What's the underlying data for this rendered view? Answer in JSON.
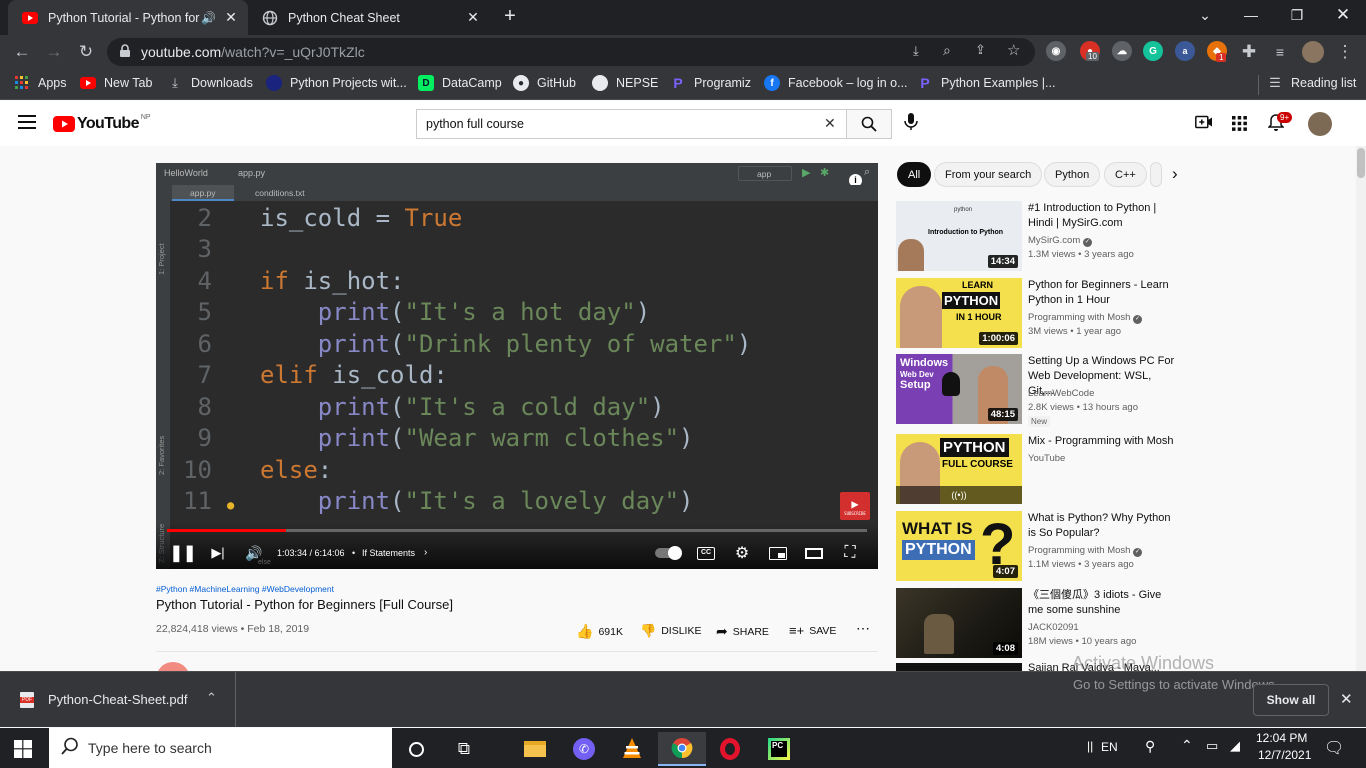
{
  "browser": {
    "tabs": [
      {
        "title": "Python Tutorial - Python for"
      },
      {
        "title": "Python Cheat Sheet"
      }
    ],
    "url_host": "youtube.com",
    "url_path": "/watch?v=_uQrJ0TkZlc",
    "extension_badges": [
      "10",
      "1"
    ],
    "bookmarks": [
      "Apps",
      "New Tab",
      "Downloads",
      "Python Projects wit...",
      "DataCamp",
      "GitHub",
      "NEPSE",
      "Programiz",
      "Facebook – log in o...",
      "Python Examples |..."
    ],
    "reading_list": "Reading list"
  },
  "youtube": {
    "logo": "YouTube",
    "region": "NP",
    "search_query": "python full course",
    "notif_count": "9+"
  },
  "player": {
    "ide_project": "HelloWorld",
    "ide_file": "app.py",
    "ide_tabs": [
      "app.py",
      "conditions.txt"
    ],
    "run_config": "app",
    "side_labels": [
      "1: Project",
      "2: Favorites",
      "Z: Structure"
    ],
    "code_lines": [
      {
        "num": "2",
        "text": "is_cold = True"
      },
      {
        "num": "3",
        "text": ""
      },
      {
        "num": "4",
        "text": "if is_hot:"
      },
      {
        "num": "5",
        "text": "    print(\"It's a hot day\")"
      },
      {
        "num": "6",
        "text": "    print(\"Drink plenty of water\")"
      },
      {
        "num": "7",
        "text": "elif is_cold:"
      },
      {
        "num": "8",
        "text": "    print(\"It's a cold day\")"
      },
      {
        "num": "9",
        "text": "    print(\"Wear warm clothes\")"
      },
      {
        "num": "10",
        "text": "else:"
      },
      {
        "num": "11",
        "text": "    print(\"It's a lovely day\")"
      }
    ],
    "time": "1:03:34 / 6:14:06",
    "chapter": "If Statements",
    "progress": 0.17,
    "subscribe": "SUBSCRIBE",
    "caption_hint": "else"
  },
  "video": {
    "hashtags": "#Python #MachineLearning #WebDevelopment",
    "title": "Python Tutorial - Python for Beginners [Full Course]",
    "views_date": "22,824,418 views • Feb 18, 2019",
    "likes": "691K",
    "dislike": "DISLIKE",
    "share": "SHARE",
    "save": "SAVE"
  },
  "chips": [
    "All",
    "From your search",
    "Python",
    "C++"
  ],
  "recommendations": [
    {
      "title": "#1 Introduction to Python | Hindi | MySirG.com",
      "channel": "MySirG.com",
      "verified": true,
      "meta": "1.3M views • 3 years ago",
      "duration": "14:34",
      "thumb_color": "#e9edf2"
    },
    {
      "title": "Python for Beginners - Learn Python in 1 Hour",
      "channel": "Programming with Mosh",
      "verified": true,
      "meta": "3M views • 1 year ago",
      "duration": "1:00:06",
      "thumb_color": "#f4e04d"
    },
    {
      "title": "Setting Up a Windows PC For Web Development: WSL, Git,...",
      "channel": "LearnWebCode",
      "verified": false,
      "meta": "2.8K views • 13 hours ago",
      "badge": "New",
      "duration": "48:15",
      "thumb_color": "#7b3fb4"
    },
    {
      "title": "Mix - Programming with Mosh",
      "channel": "YouTube",
      "verified": false,
      "meta": "",
      "duration": "",
      "thumb_color": "#f4e04d"
    },
    {
      "title": "What is Python? Why Python is So Popular?",
      "channel": "Programming with Mosh",
      "verified": true,
      "meta": "1.1M views • 3 years ago",
      "duration": "4:07",
      "thumb_color": "#f4e04d"
    },
    {
      "title": "《三個傻瓜》3 idiots - Give me some sunshine",
      "channel": "JACK02091",
      "verified": false,
      "meta": "18M views • 10 years ago",
      "duration": "4:08",
      "thumb_color": "#1c1a14"
    }
  ],
  "cutoff_rec": "Sajjan Raj Vaidya - Maya...",
  "watermark": {
    "line1": "Activate Windows",
    "line2": "Go to Settings to activate Windows."
  },
  "download": {
    "file": "Python-Cheat-Sheet.pdf",
    "show_all": "Show all"
  },
  "taskbar": {
    "search_placeholder": "Type here to search",
    "lang": "EN",
    "time": "12:04 PM",
    "date": "12/7/2021"
  }
}
